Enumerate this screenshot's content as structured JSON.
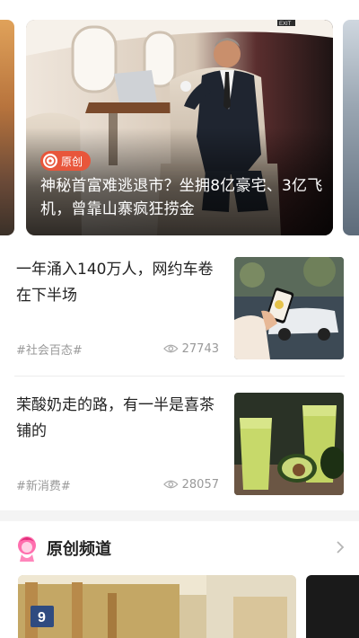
{
  "hero": {
    "badge_label": "原创",
    "title": "神秘首富难逃退市？坐拥8亿豪宅、3亿飞机，曾靠山寨疯狂捞金",
    "exit_sign": "EXIT"
  },
  "feed": [
    {
      "title": "一年涌入140万人，网约车卷在下半场",
      "tag": "#社会百态#",
      "views": "27743",
      "thumb_icon": "phone-ride-app-photo"
    },
    {
      "title": "茉酸奶走的路，有一半是喜茶铺的",
      "tag": "#新消费#",
      "views": "28057",
      "thumb_icon": "avocado-smoothie-photo"
    }
  ],
  "channel": {
    "title": "原创频道",
    "card_number": "9"
  },
  "colors": {
    "accent": "#e8563b",
    "muted": "#999999",
    "text": "#222222",
    "channel_icon": "#ff5fa2"
  }
}
